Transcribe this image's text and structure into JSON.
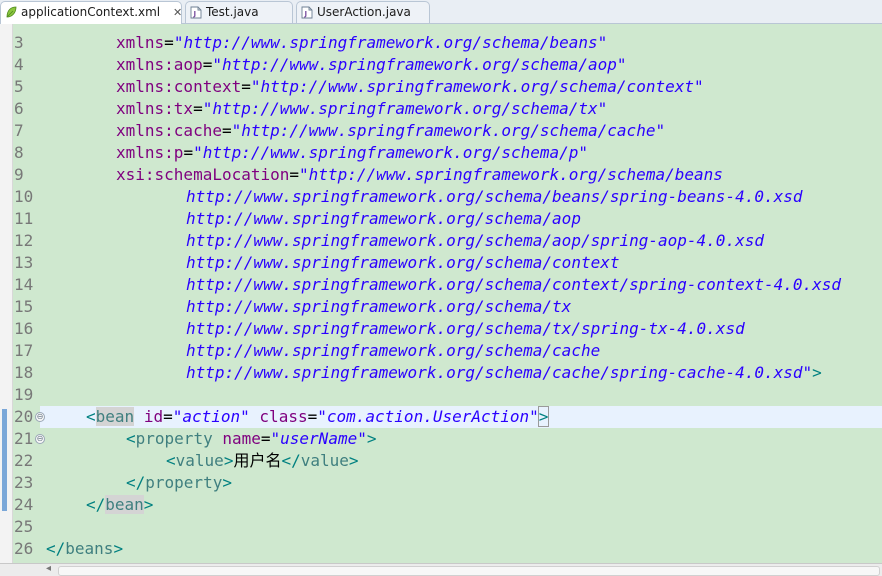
{
  "tabs": [
    {
      "label": "applicationContext.xml",
      "icon": "xml-file-icon",
      "active": true,
      "close": "✕"
    },
    {
      "label": "Test.java",
      "icon": "java-file-icon",
      "active": false
    },
    {
      "label": "UserAction.java",
      "icon": "java-file-icon",
      "active": false
    }
  ],
  "editor": {
    "line_numbers": [
      "3",
      "4",
      "5",
      "6",
      "7",
      "8",
      "9",
      "10",
      "11",
      "12",
      "13",
      "14",
      "15",
      "16",
      "17",
      "18",
      "19",
      "20",
      "21",
      "22",
      "23",
      "24",
      "25",
      "26"
    ],
    "lines": {
      "l3": {
        "attr": "xmlns",
        "eq": "=",
        "val": "\"http://www.springframework.org/schema/beans\""
      },
      "l4": {
        "attr": "xmlns:aop",
        "eq": "=",
        "val": "\"http://www.springframework.org/schema/aop\""
      },
      "l5": {
        "attr": "xmlns:context",
        "eq": "=",
        "val": "\"http://www.springframework.org/schema/context\""
      },
      "l6": {
        "attr": "xmlns:tx",
        "eq": "=",
        "val": "\"http://www.springframework.org/schema/tx\""
      },
      "l7": {
        "attr": "xmlns:cache",
        "eq": "=",
        "val": "\"http://www.springframework.org/schema/cache\""
      },
      "l8": {
        "attr": "xmlns:p",
        "eq": "=",
        "val": "\"http://www.springframework.org/schema/p\""
      },
      "l9": {
        "attr": "xsi:schemaLocation",
        "eq": "=",
        "val": "\"http://www.springframework.org/schema/beans"
      },
      "l10": {
        "val": "http://www.springframework.org/schema/beans/spring-beans-4.0.xsd"
      },
      "l11": {
        "val": "http://www.springframework.org/schema/aop"
      },
      "l12": {
        "val": "http://www.springframework.org/schema/aop/spring-aop-4.0.xsd"
      },
      "l13": {
        "val": "http://www.springframework.org/schema/context"
      },
      "l14": {
        "val": "http://www.springframework.org/schema/context/spring-context-4.0.xsd"
      },
      "l15": {
        "val": "http://www.springframework.org/schema/tx"
      },
      "l16": {
        "val": "http://www.springframework.org/schema/tx/spring-tx-4.0.xsd"
      },
      "l17": {
        "val": "http://www.springframework.org/schema/cache"
      },
      "l18": {
        "val": "http://www.springframework.org/schema/cache/spring-cache-4.0.xsd\"",
        "close": ">"
      },
      "l20": {
        "open": "<",
        "tag": "bean",
        "attr1": "id",
        "eq": "=",
        "val1": "\"action\"",
        "attr2": "class",
        "val2": "\"com.action.UserAction\"",
        "close": ">"
      },
      "l21": {
        "open": "<",
        "tag": "property",
        "attr": "name",
        "eq": "=",
        "val": "\"userName\"",
        "close": ">"
      },
      "l22": {
        "open": "<",
        "tag": "value",
        "close": ">",
        "text": "用户名",
        "open2": "</",
        "tag2": "value",
        "close2": ">"
      },
      "l23": {
        "open": "</",
        "tag": "property",
        "close": ">"
      },
      "l24": {
        "open": "</",
        "tag": "bean",
        "close": ">"
      },
      "l26": {
        "open": "</",
        "tag": "beans",
        "close": ">"
      }
    },
    "fold_markers": [
      "⊖",
      "⊖"
    ]
  },
  "colors": {
    "background": "#cfe8cf",
    "attribute": "#7f007f",
    "string": "#2a00ff",
    "tag": "#3f7f7f",
    "change_marker": "#7aa7d8"
  },
  "scrollbar": {
    "left_arrow": "◂"
  }
}
